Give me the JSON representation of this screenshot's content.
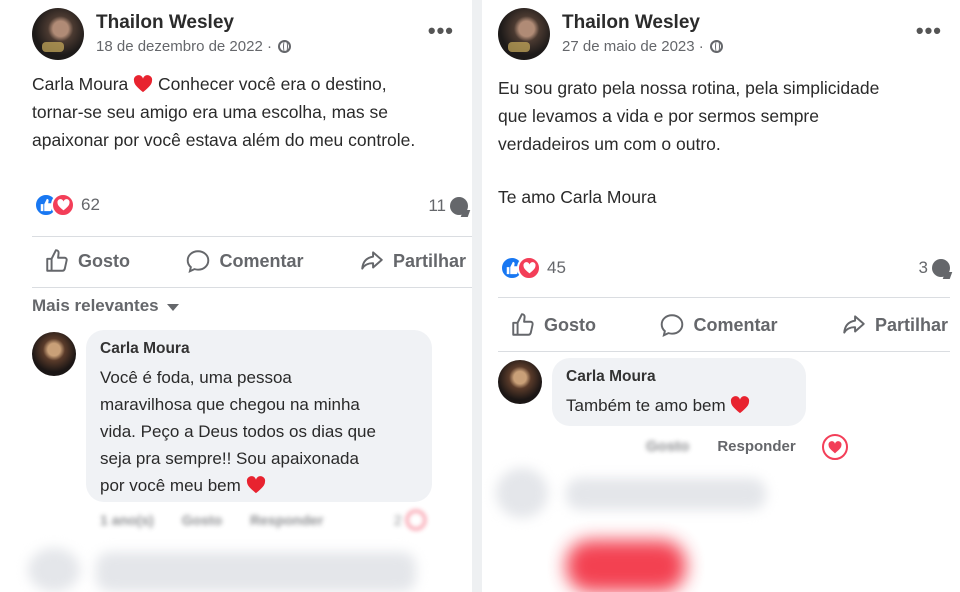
{
  "left_post": {
    "author": "Thailon Wesley",
    "date": "18 de dezembro de 2022 ·",
    "more": "•••",
    "mention": "Carla Moura",
    "text_after_mention": " Conhecer você era o destino,\ntornar-se seu amigo era uma escolha, mas se\napaixonar por você estava além do meu controle.",
    "reaction_count": "62",
    "comment_count": "11",
    "actions": {
      "like": "Gosto",
      "comment": "Comentar",
      "share": "Partilhar"
    },
    "sort_label": "Mais relevantes",
    "comment": {
      "author": "Carla Moura",
      "text": "Você é foda, uma pessoa\nmaravilhosa que chegou na minha\nvida. Peço a Deus todos os dias que\nseja pra sempre!! Sou apaixonada\npor você meu bem",
      "time": "1 ano(s)",
      "like": "Gosto",
      "reply": "Responder",
      "reactions": "2"
    }
  },
  "right_post": {
    "author": "Thailon Wesley",
    "date": "27 de maio de 2023 ·",
    "more": "•••",
    "text": "Eu sou grato pela nossa rotina, pela simplicidade\nque levamos a vida e por sermos sempre\nverdadeiros um com o outro.",
    "text2": "Te amo Carla Moura",
    "reaction_count": "45",
    "comment_count": "3",
    "actions": {
      "like": "Gosto",
      "comment": "Comentar",
      "share": "Partilhar"
    },
    "comment": {
      "author": "Carla Moura",
      "text": "Também te amo bem",
      "like": "Gosto",
      "reply": "Responder"
    }
  },
  "colors": {
    "like_blue": "#1877f2",
    "love_red": "#f33e58",
    "muted": "#65676b",
    "bubble": "#f0f2f5"
  },
  "icons": [
    "globe-icon",
    "more-icon",
    "like-reaction-icon",
    "love-reaction-icon",
    "comment-count-icon",
    "thumb-up-icon",
    "comment-icon",
    "share-icon",
    "heart-emoji-icon",
    "caret-down-icon"
  ]
}
